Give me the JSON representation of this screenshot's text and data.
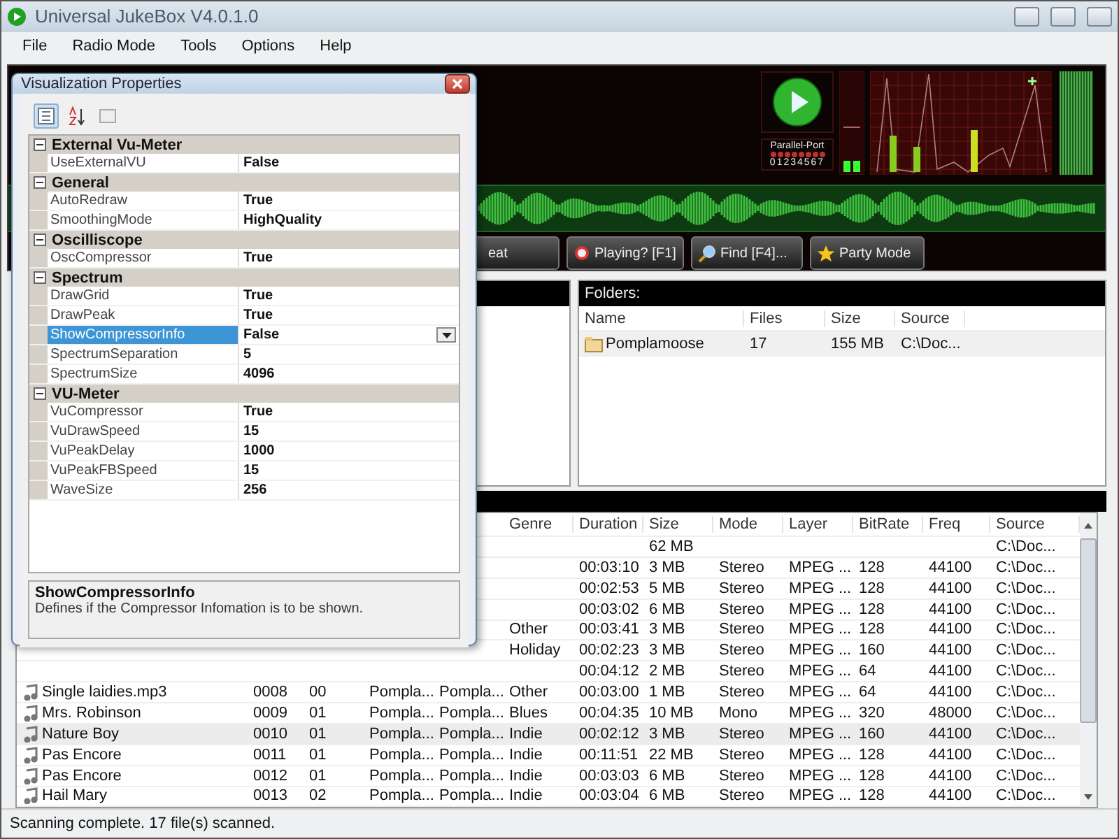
{
  "window": {
    "title": "Universal JukeBox V4.0.1.0"
  },
  "menu": [
    "File",
    "Radio Mode",
    "Tools",
    "Options",
    "Help"
  ],
  "player": {
    "port_label": "Parallel-Port",
    "port_bits": "01234567",
    "buttons": [
      {
        "label": "eat",
        "kind": "plain"
      },
      {
        "label": "Playing? [F1]",
        "kind": "playing"
      },
      {
        "label": "Find [F4]...",
        "kind": "find"
      },
      {
        "label": "Party Mode",
        "kind": "party"
      }
    ]
  },
  "folders": {
    "title": "Folders:",
    "columns": [
      "Name",
      "Files",
      "Size",
      "Source"
    ],
    "rows": [
      {
        "name": "Pomplamoose",
        "files": "17",
        "size": "155 MB",
        "source": "C:\\Doc..."
      }
    ]
  },
  "tracks": {
    "columns": [
      "Genre",
      "Duration",
      "Size",
      "Mode",
      "Layer",
      "BitRate",
      "Freq",
      "Source"
    ],
    "rows": [
      {
        "size": "62 MB",
        "source": "C:\\Doc...",
        "selected": false
      },
      {
        "duration": "00:03:10",
        "size": "3 MB",
        "mode": "Stereo",
        "layer": "MPEG ...",
        "bitrate": "128",
        "freq": "44100",
        "source": "C:\\Doc...",
        "selected": false
      },
      {
        "duration": "00:02:53",
        "size": "5 MB",
        "mode": "Stereo",
        "layer": "MPEG ...",
        "bitrate": "128",
        "freq": "44100",
        "source": "C:\\Doc...",
        "selected": false
      },
      {
        "duration": "00:03:02",
        "size": "6 MB",
        "mode": "Stereo",
        "layer": "MPEG ...",
        "bitrate": "128",
        "freq": "44100",
        "source": "C:\\Doc...",
        "selected": false
      },
      {
        "genre": "Other",
        "duration": "00:03:41",
        "size": "3 MB",
        "mode": "Stereo",
        "layer": "MPEG ...",
        "bitrate": "128",
        "freq": "44100",
        "source": "C:\\Doc...",
        "selected": false
      },
      {
        "genre": "Holiday",
        "duration": "00:02:23",
        "size": "3 MB",
        "mode": "Stereo",
        "layer": "MPEG ...",
        "bitrate": "160",
        "freq": "44100",
        "source": "C:\\Doc...",
        "selected": false
      },
      {
        "duration": "00:04:12",
        "size": "2 MB",
        "mode": "Stereo",
        "layer": "MPEG ...",
        "bitrate": "64",
        "freq": "44100",
        "source": "C:\\Doc...",
        "selected": false
      },
      {
        "title": "Single laidies.mp3",
        "col_2": "0008",
        "col_3": "00",
        "col_4": "Pompla...",
        "col_5": "Pompla...",
        "genre": "Other",
        "duration": "00:03:00",
        "size": "1 MB",
        "mode": "Stereo",
        "layer": "MPEG ...",
        "bitrate": "64",
        "freq": "44100",
        "source": "C:\\Doc...",
        "selected": false
      },
      {
        "title": "Mrs. Robinson",
        "col_2": "0009",
        "col_3": "01",
        "col_4": "Pompla...",
        "col_5": "Pompla...",
        "genre": "Blues",
        "duration": "00:04:35",
        "size": "10 MB",
        "mode": "Mono",
        "layer": "MPEG ...",
        "bitrate": "320",
        "freq": "48000",
        "source": "C:\\Doc...",
        "selected": false
      },
      {
        "title": "Nature Boy",
        "col_2": "0010",
        "col_3": "01",
        "col_4": "Pompla...",
        "col_5": "Pompla...",
        "genre": "Indie",
        "duration": "00:02:12",
        "size": "3 MB",
        "mode": "Stereo",
        "layer": "MPEG ...",
        "bitrate": "160",
        "freq": "44100",
        "source": "C:\\Doc...",
        "selected": true
      },
      {
        "title": "Pas Encore",
        "col_2": "0011",
        "col_3": "01",
        "col_4": "Pompla...",
        "col_5": "Pompla...",
        "genre": "Indie",
        "duration": "00:11:51",
        "size": "22 MB",
        "mode": "Stereo",
        "layer": "MPEG ...",
        "bitrate": "128",
        "freq": "44100",
        "source": "C:\\Doc...",
        "selected": false
      },
      {
        "title": "Pas Encore",
        "col_2": "0012",
        "col_3": "01",
        "col_4": "Pompla...",
        "col_5": "Pompla...",
        "genre": "Indie",
        "duration": "00:03:03",
        "size": "6 MB",
        "mode": "Stereo",
        "layer": "MPEG ...",
        "bitrate": "128",
        "freq": "44100",
        "source": "C:\\Doc...",
        "selected": false
      },
      {
        "title": "Hail Mary",
        "col_2": "0013",
        "col_3": "02",
        "col_4": "Pompla...",
        "col_5": "Pompla...",
        "genre": "Indie",
        "duration": "00:03:04",
        "size": "6 MB",
        "mode": "Stereo",
        "layer": "MPEG ...",
        "bitrate": "128",
        "freq": "44100",
        "source": "C:\\Doc...",
        "selected": false
      }
    ]
  },
  "status_bar": "Scanning complete. 17 file(s) scanned.",
  "dialog": {
    "title": "Visualization Properties",
    "categories": [
      {
        "name": "External Vu-Meter",
        "expanded": true,
        "properties": [
          {
            "name": "UseExternalVU",
            "value": "False",
            "selected": false
          }
        ]
      },
      {
        "name": "General",
        "expanded": true,
        "properties": [
          {
            "name": "AutoRedraw",
            "value": "True",
            "selected": false
          },
          {
            "name": "SmoothingMode",
            "value": "HighQuality",
            "selected": false
          }
        ]
      },
      {
        "name": "Oscilliscope",
        "expanded": true,
        "properties": [
          {
            "name": "OscCompressor",
            "value": "True",
            "selected": false
          }
        ]
      },
      {
        "name": "Spectrum",
        "expanded": true,
        "properties": [
          {
            "name": "DrawGrid",
            "value": "True",
            "selected": false
          },
          {
            "name": "DrawPeak",
            "value": "True",
            "selected": false
          },
          {
            "name": "ShowCompressorInfo",
            "value": "False",
            "selected": true
          },
          {
            "name": "SpectrumSeparation",
            "value": "5",
            "selected": false
          },
          {
            "name": "SpectrumSize",
            "value": "4096",
            "selected": false
          }
        ]
      },
      {
        "name": "VU-Meter",
        "expanded": true,
        "properties": [
          {
            "name": "VuCompressor",
            "value": "True",
            "selected": false
          },
          {
            "name": "VuDrawSpeed",
            "value": "15",
            "selected": false
          },
          {
            "name": "VuPeakDelay",
            "value": "1000",
            "selected": false
          },
          {
            "name": "VuPeakFBSpeed",
            "value": "15",
            "selected": false
          },
          {
            "name": "WaveSize",
            "value": "256",
            "selected": false
          }
        ]
      }
    ],
    "description": {
      "title": "ShowCompressorInfo",
      "text": "Defines if the Compressor Infomation is to be shown."
    }
  }
}
